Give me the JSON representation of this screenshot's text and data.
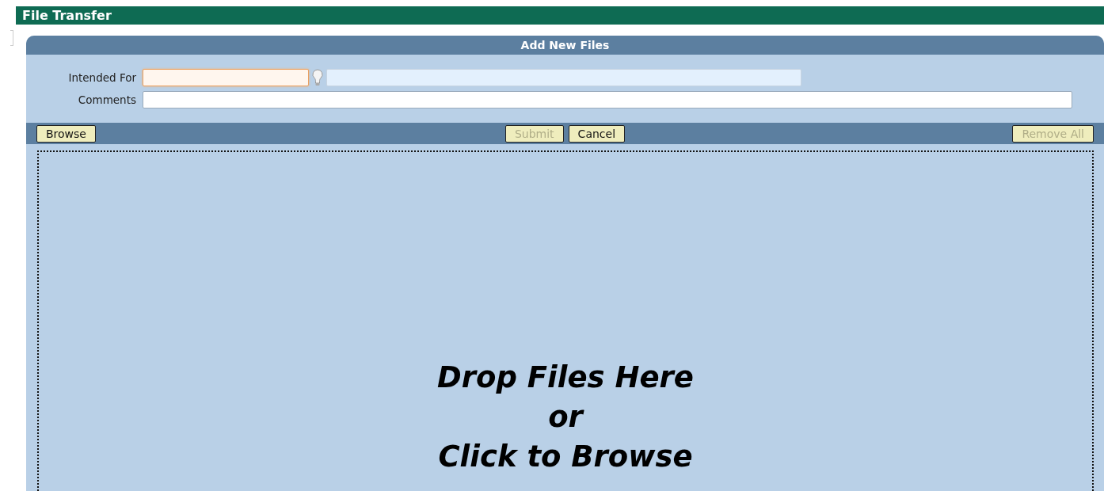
{
  "title_bar": {
    "title": "File Transfer"
  },
  "panel": {
    "title": "Add New Files",
    "intended_for": {
      "label": "Intended For",
      "focused": true
    },
    "comments": {
      "label": "Comments"
    },
    "toolbar": {
      "left": [
        {
          "label": "Browse",
          "disabled": false
        }
      ],
      "center": [
        {
          "label": "Submit",
          "disabled": true
        },
        {
          "label": "Cancel",
          "disabled": false
        }
      ],
      "right": [
        {
          "label": "Remove All",
          "disabled": true
        }
      ]
    },
    "drop_zone": {
      "lines": [
        "Drop Files Here",
        "or",
        "Click to Browse"
      ]
    }
  }
}
